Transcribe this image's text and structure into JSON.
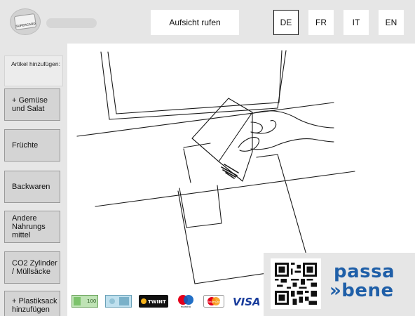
{
  "header": {
    "supercard_logo_text": "SUPERCARD",
    "assist_button": "Aufsicht rufen",
    "languages": [
      {
        "code": "DE",
        "active": true
      },
      {
        "code": "FR",
        "active": false
      },
      {
        "code": "IT",
        "active": false
      },
      {
        "code": "EN",
        "active": false
      }
    ]
  },
  "sidebar": {
    "hint": "Artikel hinzufügen:",
    "items": [
      {
        "label": "+ Gemüse und Salat"
      },
      {
        "label": "Früchte"
      },
      {
        "label": "Backwaren"
      },
      {
        "label": "Andere Nahrungs mittel"
      },
      {
        "label": "CO2 Zylinder / Müllsäcke"
      },
      {
        "label": "+ Plastiksack hinzufügen"
      }
    ]
  },
  "payments": [
    {
      "icon": "banknote-100-icon",
      "label": "100"
    },
    {
      "icon": "banknote-icon",
      "label": ""
    },
    {
      "icon": "twint-icon",
      "label": "TWINT"
    },
    {
      "icon": "maestro-icon",
      "label": "maestro"
    },
    {
      "icon": "mastercard-icon",
      "label": "MasterCard"
    },
    {
      "icon": "visa-icon",
      "label": "VISA"
    }
  ],
  "brand": {
    "line1": "passa",
    "line2": "»bene",
    "color": "#1f5fa8"
  },
  "colors": {
    "background": "#e6e6e6",
    "button_gray": "#d4d4d4",
    "brand_blue": "#1f5fa8"
  }
}
